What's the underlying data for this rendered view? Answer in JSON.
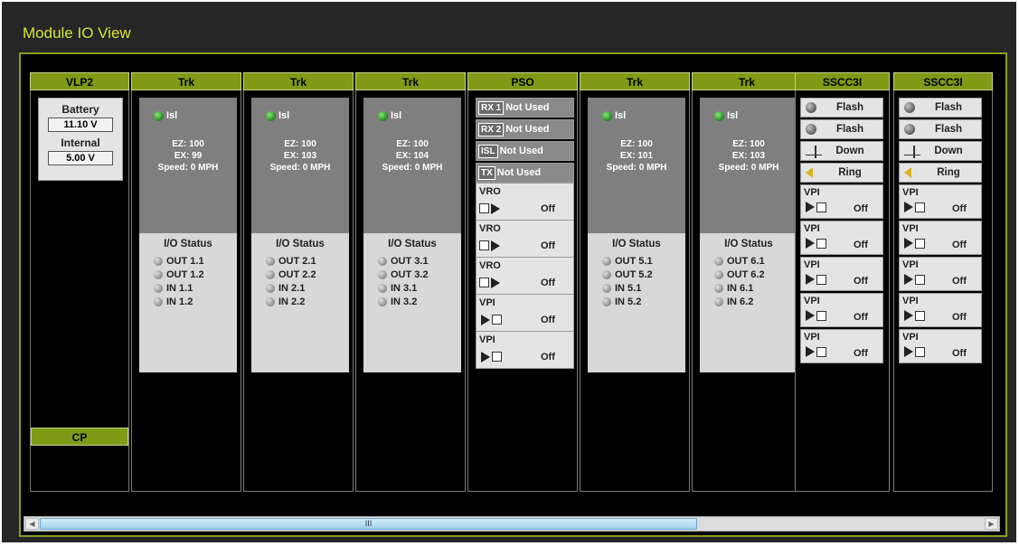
{
  "app": {
    "title": "Module IO View"
  },
  "vlp2": {
    "header": "VLP2",
    "battery_label": "Battery",
    "battery_value": "11.10 V",
    "internal_label": "Internal",
    "internal_value": "5.00 V",
    "cp_header": "CP"
  },
  "trk_modules": [
    {
      "header": "Trk",
      "isl": "Isl",
      "ez": "EZ: 100",
      "ex": "EX: 99",
      "speed": "Speed: 0 MPH",
      "io_title": "I/O Status",
      "io": [
        "OUT 1.1",
        "OUT 1.2",
        "IN 1.1",
        "IN 1.2"
      ]
    },
    {
      "header": "Trk",
      "isl": "Isl",
      "ez": "EZ: 100",
      "ex": "EX: 103",
      "speed": "Speed: 0 MPH",
      "io_title": "I/O Status",
      "io": [
        "OUT 2.1",
        "OUT 2.2",
        "IN 2.1",
        "IN 2.2"
      ]
    },
    {
      "header": "Trk",
      "isl": "Isl",
      "ez": "EZ: 100",
      "ex": "EX: 104",
      "speed": "Speed: 0 MPH",
      "io_title": "I/O Status",
      "io": [
        "OUT 3.1",
        "OUT 3.2",
        "IN 3.1",
        "IN 3.2"
      ]
    },
    {
      "header": "Trk",
      "isl": "Isl",
      "ez": "EZ: 100",
      "ex": "EX: 101",
      "speed": "Speed: 0 MPH",
      "io_title": "I/O Status",
      "io": [
        "OUT 5.1",
        "OUT 5.2",
        "IN 5.1",
        "IN 5.2"
      ]
    },
    {
      "header": "Trk",
      "isl": "Isl",
      "ez": "EZ: 100",
      "ex": "EX: 103",
      "speed": "Speed: 0 MPH",
      "io_title": "I/O Status",
      "io": [
        "OUT 6.1",
        "OUT 6.2",
        "IN 6.1",
        "IN 6.2"
      ]
    }
  ],
  "pso": {
    "header": "PSO",
    "rows": [
      {
        "tag": "RX 1",
        "status": "Not Used"
      },
      {
        "tag": "RX 2",
        "status": "Not Used"
      },
      {
        "tag": "ISL",
        "status": "Not Used"
      },
      {
        "tag": "TX",
        "status": "Not Used"
      }
    ],
    "controls": [
      {
        "label": "VRO",
        "state": "Off"
      },
      {
        "label": "VRO",
        "state": "Off"
      },
      {
        "label": "VRO",
        "state": "Off"
      },
      {
        "label": "VPI",
        "state": "Off"
      },
      {
        "label": "VPI",
        "state": "Off"
      }
    ]
  },
  "sscc": [
    {
      "header": "SSCC3I",
      "buttons": [
        "Flash",
        "Flash",
        "Down",
        "Ring"
      ],
      "vpi": [
        {
          "label": "VPI",
          "state": "Off"
        },
        {
          "label": "VPI",
          "state": "Off"
        },
        {
          "label": "VPI",
          "state": "Off"
        },
        {
          "label": "VPI",
          "state": "Off"
        },
        {
          "label": "VPI",
          "state": "Off"
        }
      ]
    },
    {
      "header": "SSCC3I",
      "buttons": [
        "Flash",
        "Flash",
        "Down",
        "Ring"
      ],
      "vpi": [
        {
          "label": "VPI",
          "state": "Off"
        },
        {
          "label": "VPI",
          "state": "Off"
        },
        {
          "label": "VPI",
          "state": "Off"
        },
        {
          "label": "VPI",
          "state": "Off"
        },
        {
          "label": "VPI",
          "state": "Off"
        }
      ]
    }
  ],
  "scrollbar": {
    "thumb_glyph": "III"
  },
  "colors": {
    "title": "#d7e33b",
    "header": "#7f9a15",
    "frame": "#8d9a22",
    "panel_dark": "#7f7f7f",
    "panel_light": "#d8d8d8"
  }
}
